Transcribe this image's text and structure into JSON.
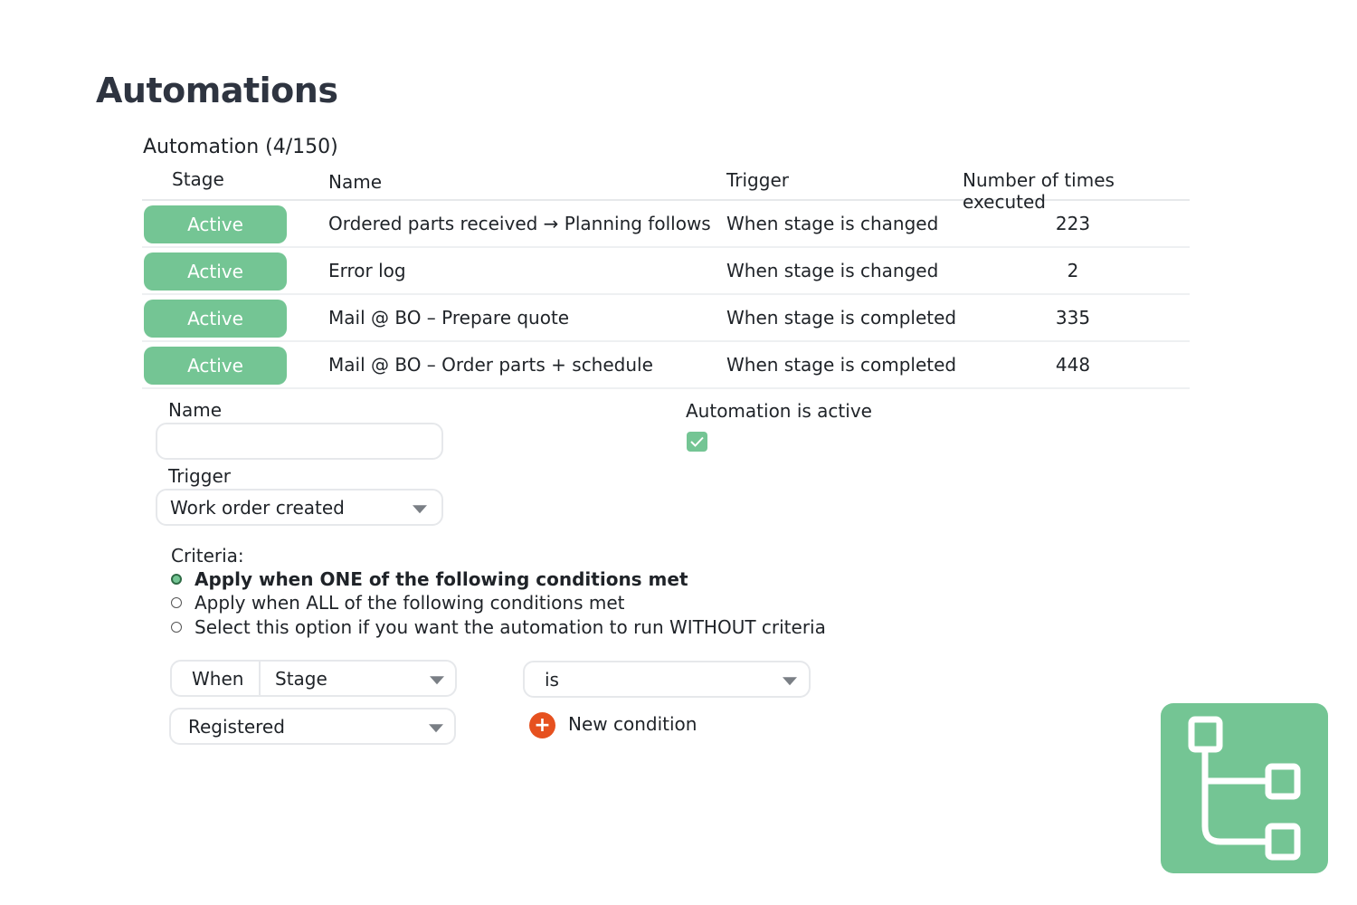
{
  "page": {
    "title": "Automations"
  },
  "section": {
    "title": "Automation (4/150)"
  },
  "table": {
    "headers": {
      "stage": "Stage",
      "name": "Name",
      "trigger": "Trigger",
      "count": "Number of times executed"
    },
    "rows": [
      {
        "stage": "Active",
        "name": "Ordered parts received → Planning follows",
        "trigger": "When stage is changed",
        "count": "223"
      },
      {
        "stage": "Active",
        "name": "Error log",
        "trigger": "When stage is changed",
        "count": "2"
      },
      {
        "stage": "Active",
        "name": "Mail @ BO – Prepare quote",
        "trigger": "When stage is completed",
        "count": "335"
      },
      {
        "stage": "Active",
        "name": "Mail @ BO – Order parts + schedule",
        "trigger": "When stage is completed",
        "count": "448"
      }
    ]
  },
  "form": {
    "name_label": "Name",
    "name_value": "",
    "active_label": "Automation is active",
    "active_checked": true,
    "trigger_label": "Trigger",
    "trigger_value": "Work order created",
    "criteria_label": "Criteria:",
    "criteria_options": [
      {
        "label": "Apply when ONE of the following conditions met",
        "selected": true
      },
      {
        "label": "Apply when ALL of the following conditions met",
        "selected": false
      },
      {
        "label": "Select this option if you want the automation to run WITHOUT criteria",
        "selected": false
      }
    ],
    "condition": {
      "when_label": "When",
      "field_value": "Stage",
      "operator_value": "is",
      "value_value": "Registered"
    },
    "new_condition_label": "New condition",
    "new_condition_icon": "plus-icon"
  },
  "colors": {
    "accent": "#74c594",
    "add": "#e6511f",
    "border": "#e6e8eb"
  },
  "decoration": {
    "icon": "flow-tree-icon"
  }
}
